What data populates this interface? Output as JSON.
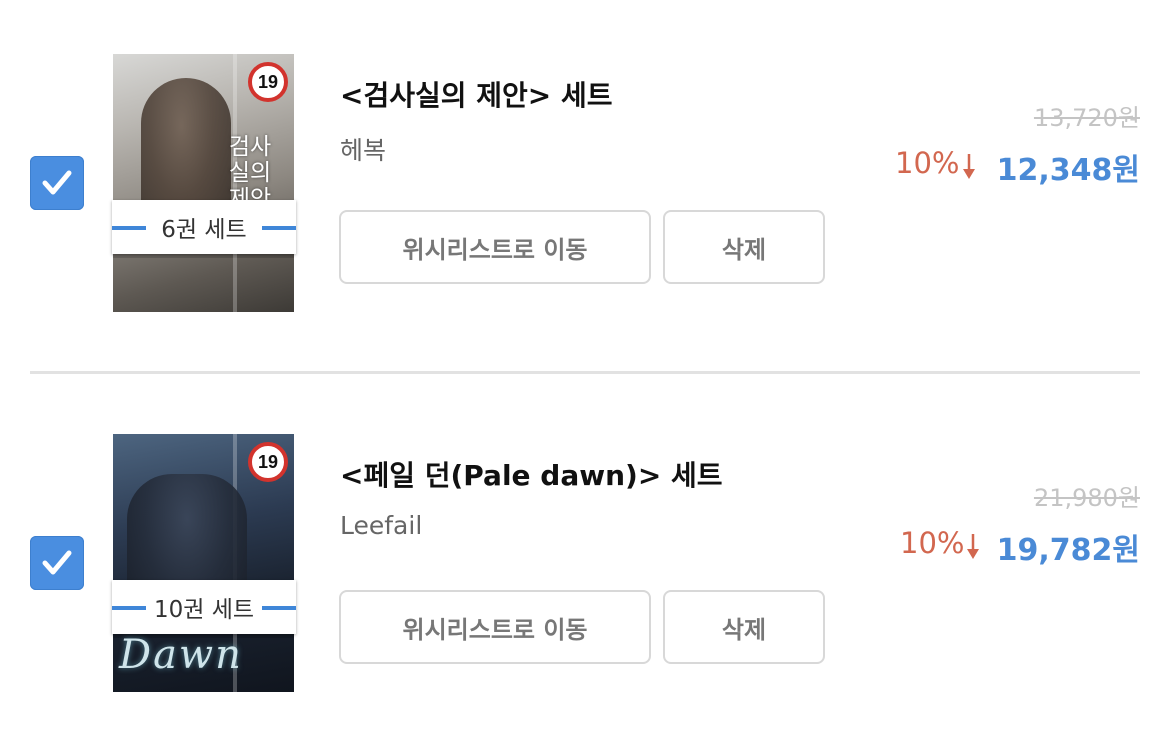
{
  "colors": {
    "accent": "#4a8ee0",
    "price": "#4a8ad6",
    "discount": "#d2674f",
    "strike": "#c4c4c4",
    "divider": "#e2e2e2",
    "age_badge_ring": "#d2332d"
  },
  "items": [
    {
      "checked": true,
      "cover": {
        "age_badge": "19",
        "title_text": "검사실의 제안",
        "script_text": ""
      },
      "set_label": "6권 세트",
      "title": "<검사실의 제안> 세트",
      "author": "헤복",
      "buttons": {
        "wishlist": "위시리스트로 이동",
        "delete": "삭제"
      },
      "original_price": "13,720원",
      "discount": "10%",
      "discount_icon": "arrow-down-icon",
      "price": "12,348원"
    },
    {
      "checked": true,
      "cover": {
        "age_badge": "19",
        "title_text": "",
        "script_text": "Pale Dawn"
      },
      "set_label": "10권 세트",
      "title": "<페일 던(Pale dawn)> 세트",
      "author": "Leefail",
      "buttons": {
        "wishlist": "위시리스트로 이동",
        "delete": "삭제"
      },
      "original_price": "21,980원",
      "discount": "10%",
      "discount_icon": "arrow-down-icon",
      "price": "19,782원"
    }
  ]
}
